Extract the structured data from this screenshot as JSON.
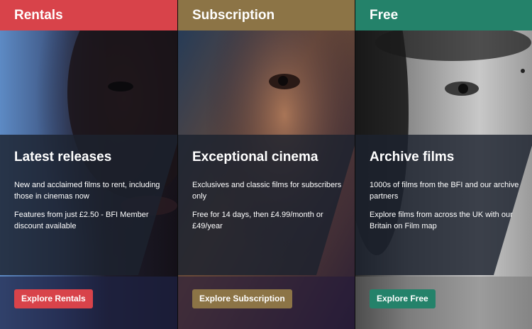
{
  "panels": [
    {
      "tab": "Rentals",
      "title": "Latest releases",
      "description": "New and acclaimed films to rent, including those in cinemas now",
      "detail": "Features from just £2.50 - BFI Member discount available",
      "button": "Explore Rentals",
      "accent": "#d8434a"
    },
    {
      "tab": "Subscription",
      "title": "Exceptional cinema",
      "description": "Exclusives and classic films for subscribers only",
      "detail": "Free for 14 days, then £4.99/month or £49/year",
      "button": "Explore Subscription",
      "accent": "#8c7446"
    },
    {
      "tab": "Free",
      "title": "Archive films",
      "description": "1000s of films from the BFI and our archive partners",
      "detail": "Explore films from across the UK with our Britain on Film map",
      "button": "Explore Free",
      "accent": "#24826a"
    }
  ]
}
